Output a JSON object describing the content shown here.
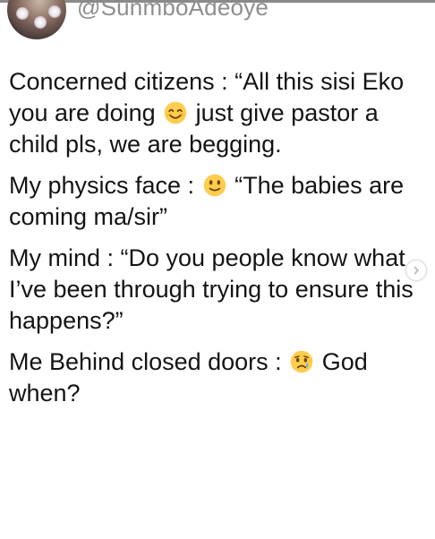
{
  "post": {
    "handle": "@SunmboAdeoye",
    "paragraphs": [
      {
        "parts": [
          {
            "text": "Concerned citizens : “All this sisi Eko you are doing "
          },
          {
            "emoji": "smiling-face-with-smiling-eyes-emoji"
          },
          {
            "text": " just give pastor a child pls, we are begging."
          }
        ]
      },
      {
        "parts": [
          {
            "text": "My physics face : "
          },
          {
            "emoji": "slightly-smiling-face-emoji"
          },
          {
            "text": " “The babies are coming ma/sir”"
          }
        ]
      },
      {
        "parts": [
          {
            "text": "My mind : “Do you people know what I’ve been through trying to ensure this happens?”"
          }
        ]
      },
      {
        "parts": [
          {
            "text": "Me Behind closed doors : "
          },
          {
            "emoji": "crying-face-emoji"
          },
          {
            "text": " God when?"
          }
        ]
      }
    ]
  },
  "icons": {
    "avatar": "profile-avatar",
    "next": "chevron-right-icon"
  },
  "colors": {
    "text": "#141414",
    "handle": "#8e8e8e",
    "emoji_yellow": "#FFCC4D",
    "emoji_dark": "#664500",
    "tear_blue": "#5DADEC"
  }
}
